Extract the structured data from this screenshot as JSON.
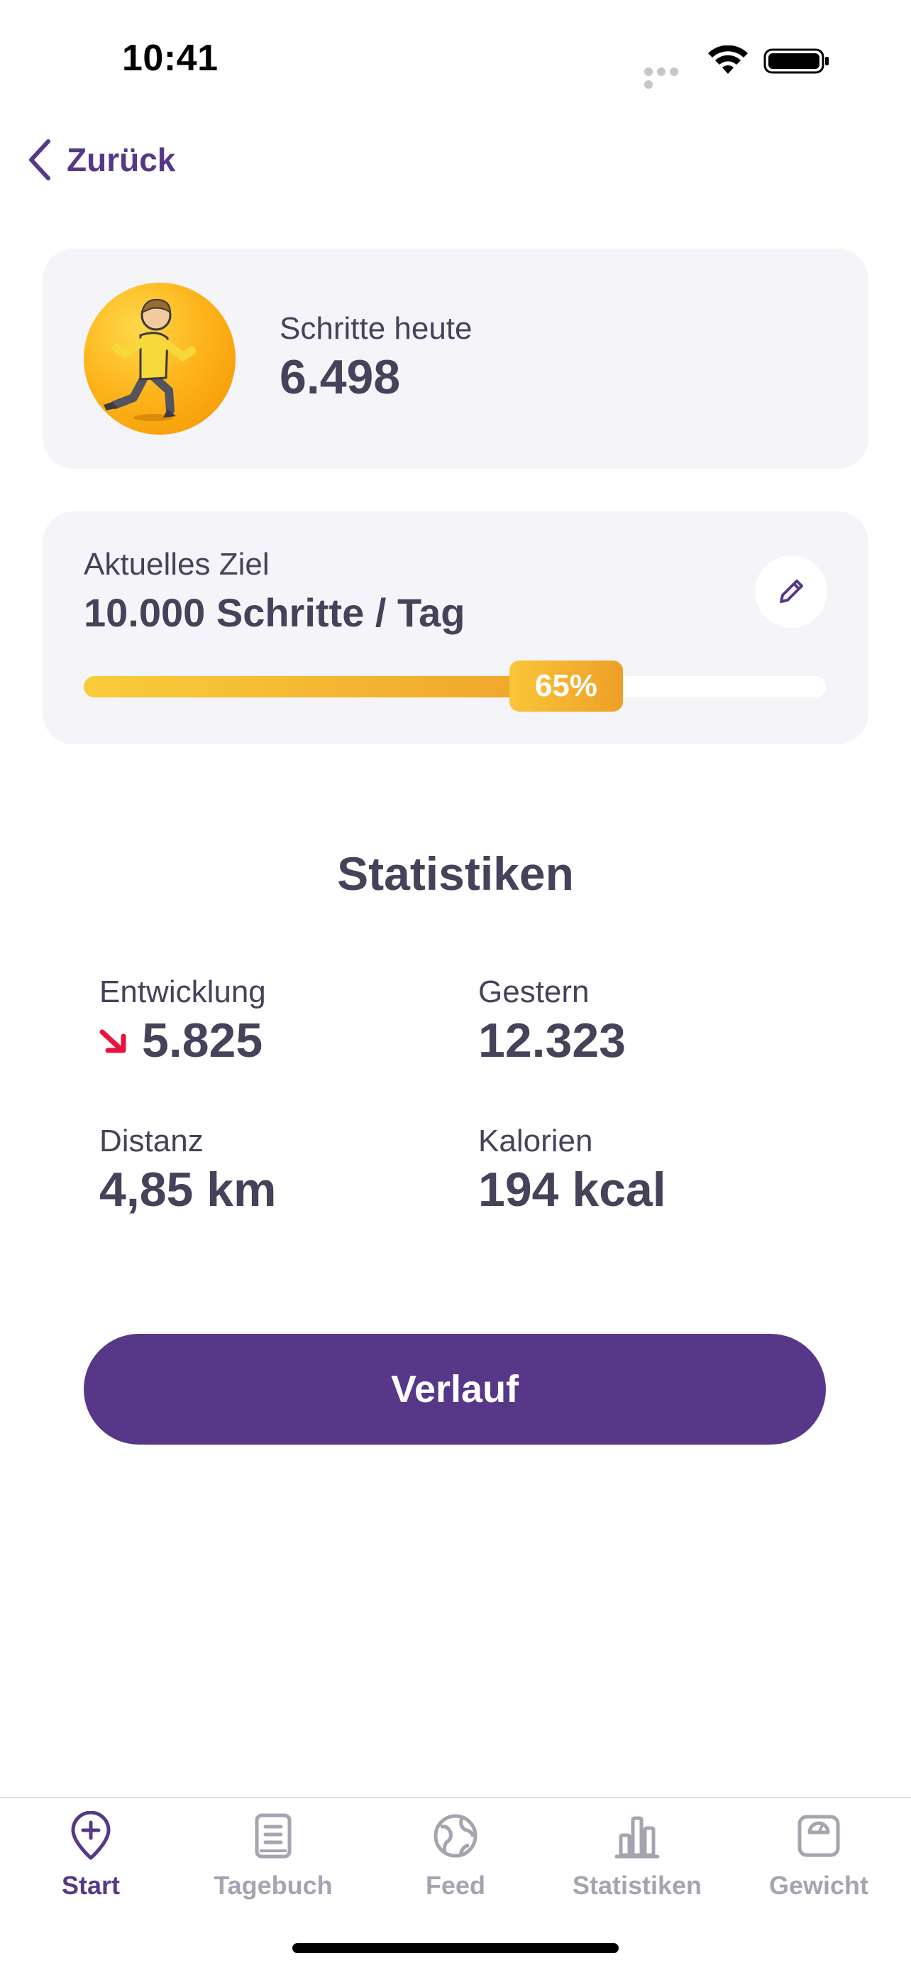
{
  "status_bar": {
    "time": "10:41"
  },
  "nav": {
    "back_label": "Zurück"
  },
  "today_card": {
    "label": "Schritte heute",
    "value": "6.498"
  },
  "goal_card": {
    "label": "Aktuelles Ziel",
    "value": "10.000 Schritte / Tag",
    "progress_percent": 65,
    "progress_label": "65%"
  },
  "stats": {
    "title": "Statistiken",
    "items": [
      {
        "label": "Entwicklung",
        "value": "5.825",
        "trend": "down"
      },
      {
        "label": "Gestern",
        "value": "12.323"
      },
      {
        "label": "Distanz",
        "value": "4,85 km"
      },
      {
        "label": "Kalorien",
        "value": "194 kcal"
      }
    ]
  },
  "cta": {
    "label": "Verlauf"
  },
  "tabbar": {
    "items": [
      {
        "label": "Start",
        "icon": "map-pin-plus-icon",
        "active": true
      },
      {
        "label": "Tagebuch",
        "icon": "notebook-icon",
        "active": false
      },
      {
        "label": "Feed",
        "icon": "globe-icon",
        "active": false
      },
      {
        "label": "Statistiken",
        "icon": "bar-chart-icon",
        "active": false
      },
      {
        "label": "Gewicht",
        "icon": "scale-icon",
        "active": false
      }
    ]
  },
  "colors": {
    "brand": "#573888",
    "text": "#45435a",
    "card": "#f4f4f9",
    "progress": "#f4b22f",
    "trend_down": "#e8123c",
    "tab_inactive": "#a5a4b0"
  }
}
